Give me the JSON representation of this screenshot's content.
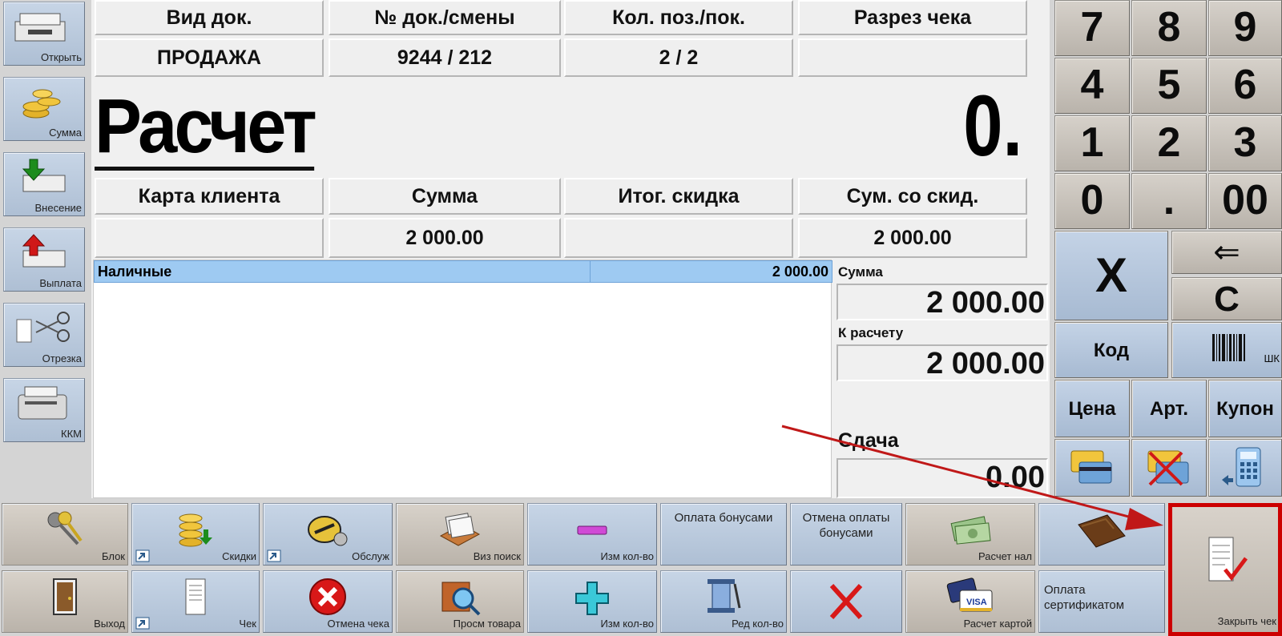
{
  "sidebar": {
    "open": "Открыть",
    "sum": "Сумма",
    "deposit": "Внесение",
    "payout": "Выплата",
    "cut": "Отрезка",
    "kkm": "ККМ"
  },
  "header": {
    "doc_type_label": "Вид док.",
    "doc_no_label": "№ док./смены",
    "qty_label": "Кол. поз./пок.",
    "cut_label": "Разрез чека",
    "doc_type_value": "ПРОДАЖА",
    "doc_no_value": "9244 / 212",
    "qty_value": "2 / 2",
    "cut_value": ""
  },
  "calc": {
    "title": "Расчет",
    "amount": "0."
  },
  "totals": {
    "client_card_label": "Карта клиента",
    "sum_label": "Сумма",
    "discount_label": "Итог. скидка",
    "sum_disc_label": "Сум. со скид.",
    "client_card_value": "",
    "sum_value": "2 000.00",
    "discount_value": "",
    "sum_disc_value": "2 000.00"
  },
  "payments": [
    {
      "name": "Наличные",
      "amount": "2 000.00"
    }
  ],
  "right_panel": {
    "sum_label": "Сумма",
    "sum_value": "2 000.00",
    "due_label": "К расчету",
    "due_value": "2 000.00",
    "change_label": "Сдача",
    "change_value": "0.00"
  },
  "keypad": {
    "digits": [
      "7",
      "8",
      "9",
      "4",
      "5",
      "6",
      "1",
      "2",
      "3",
      "0",
      ".",
      "00"
    ],
    "multiply": "X",
    "backspace": "⇐",
    "clear": "C",
    "code": "Код",
    "barcode": "ШК",
    "price": "Цена",
    "article": "Арт.",
    "coupon": "Купон"
  },
  "bottom": {
    "block": "Блок",
    "discounts": "Скидки",
    "service": "Обслуж",
    "visual_search": "Виз поиск",
    "qty_minus": "Изм кол-во",
    "pay_bonus": "Оплата бонусами",
    "cancel_bonus": "Отмена оплаты бонусами",
    "cash_payment": "Расчет нал",
    "exit": "Выход",
    "check": "Чек",
    "cancel_check": "Отмена чека",
    "view_goods": "Просм товара",
    "qty_plus": "Изм кол-во",
    "edit_qty": "Ред кол-во",
    "card_payment": "Расчет картой",
    "pay_certificate": "Оплата сертификатом",
    "close_check": "Закрыть чек"
  },
  "colors": {
    "selection": "#9ecaf2",
    "highlight_border": "#cc0000",
    "arrow": "#c01818"
  }
}
